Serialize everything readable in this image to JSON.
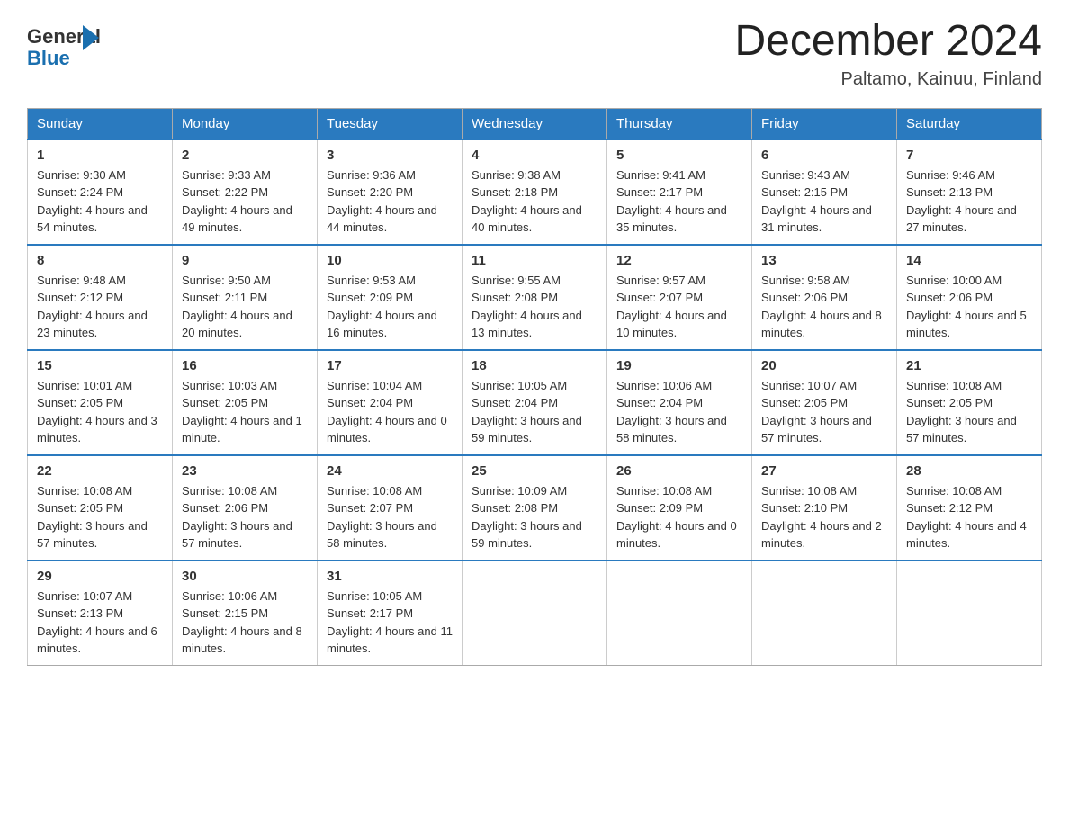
{
  "header": {
    "logo_general": "General",
    "logo_blue": "Blue",
    "month_title": "December 2024",
    "location": "Paltamo, Kainuu, Finland"
  },
  "columns": [
    "Sunday",
    "Monday",
    "Tuesday",
    "Wednesday",
    "Thursday",
    "Friday",
    "Saturday"
  ],
  "weeks": [
    [
      {
        "day": "1",
        "sunrise": "Sunrise: 9:30 AM",
        "sunset": "Sunset: 2:24 PM",
        "daylight": "Daylight: 4 hours and 54 minutes."
      },
      {
        "day": "2",
        "sunrise": "Sunrise: 9:33 AM",
        "sunset": "Sunset: 2:22 PM",
        "daylight": "Daylight: 4 hours and 49 minutes."
      },
      {
        "day": "3",
        "sunrise": "Sunrise: 9:36 AM",
        "sunset": "Sunset: 2:20 PM",
        "daylight": "Daylight: 4 hours and 44 minutes."
      },
      {
        "day": "4",
        "sunrise": "Sunrise: 9:38 AM",
        "sunset": "Sunset: 2:18 PM",
        "daylight": "Daylight: 4 hours and 40 minutes."
      },
      {
        "day": "5",
        "sunrise": "Sunrise: 9:41 AM",
        "sunset": "Sunset: 2:17 PM",
        "daylight": "Daylight: 4 hours and 35 minutes."
      },
      {
        "day": "6",
        "sunrise": "Sunrise: 9:43 AM",
        "sunset": "Sunset: 2:15 PM",
        "daylight": "Daylight: 4 hours and 31 minutes."
      },
      {
        "day": "7",
        "sunrise": "Sunrise: 9:46 AM",
        "sunset": "Sunset: 2:13 PM",
        "daylight": "Daylight: 4 hours and 27 minutes."
      }
    ],
    [
      {
        "day": "8",
        "sunrise": "Sunrise: 9:48 AM",
        "sunset": "Sunset: 2:12 PM",
        "daylight": "Daylight: 4 hours and 23 minutes."
      },
      {
        "day": "9",
        "sunrise": "Sunrise: 9:50 AM",
        "sunset": "Sunset: 2:11 PM",
        "daylight": "Daylight: 4 hours and 20 minutes."
      },
      {
        "day": "10",
        "sunrise": "Sunrise: 9:53 AM",
        "sunset": "Sunset: 2:09 PM",
        "daylight": "Daylight: 4 hours and 16 minutes."
      },
      {
        "day": "11",
        "sunrise": "Sunrise: 9:55 AM",
        "sunset": "Sunset: 2:08 PM",
        "daylight": "Daylight: 4 hours and 13 minutes."
      },
      {
        "day": "12",
        "sunrise": "Sunrise: 9:57 AM",
        "sunset": "Sunset: 2:07 PM",
        "daylight": "Daylight: 4 hours and 10 minutes."
      },
      {
        "day": "13",
        "sunrise": "Sunrise: 9:58 AM",
        "sunset": "Sunset: 2:06 PM",
        "daylight": "Daylight: 4 hours and 8 minutes."
      },
      {
        "day": "14",
        "sunrise": "Sunrise: 10:00 AM",
        "sunset": "Sunset: 2:06 PM",
        "daylight": "Daylight: 4 hours and 5 minutes."
      }
    ],
    [
      {
        "day": "15",
        "sunrise": "Sunrise: 10:01 AM",
        "sunset": "Sunset: 2:05 PM",
        "daylight": "Daylight: 4 hours and 3 minutes."
      },
      {
        "day": "16",
        "sunrise": "Sunrise: 10:03 AM",
        "sunset": "Sunset: 2:05 PM",
        "daylight": "Daylight: 4 hours and 1 minute."
      },
      {
        "day": "17",
        "sunrise": "Sunrise: 10:04 AM",
        "sunset": "Sunset: 2:04 PM",
        "daylight": "Daylight: 4 hours and 0 minutes."
      },
      {
        "day": "18",
        "sunrise": "Sunrise: 10:05 AM",
        "sunset": "Sunset: 2:04 PM",
        "daylight": "Daylight: 3 hours and 59 minutes."
      },
      {
        "day": "19",
        "sunrise": "Sunrise: 10:06 AM",
        "sunset": "Sunset: 2:04 PM",
        "daylight": "Daylight: 3 hours and 58 minutes."
      },
      {
        "day": "20",
        "sunrise": "Sunrise: 10:07 AM",
        "sunset": "Sunset: 2:05 PM",
        "daylight": "Daylight: 3 hours and 57 minutes."
      },
      {
        "day": "21",
        "sunrise": "Sunrise: 10:08 AM",
        "sunset": "Sunset: 2:05 PM",
        "daylight": "Daylight: 3 hours and 57 minutes."
      }
    ],
    [
      {
        "day": "22",
        "sunrise": "Sunrise: 10:08 AM",
        "sunset": "Sunset: 2:05 PM",
        "daylight": "Daylight: 3 hours and 57 minutes."
      },
      {
        "day": "23",
        "sunrise": "Sunrise: 10:08 AM",
        "sunset": "Sunset: 2:06 PM",
        "daylight": "Daylight: 3 hours and 57 minutes."
      },
      {
        "day": "24",
        "sunrise": "Sunrise: 10:08 AM",
        "sunset": "Sunset: 2:07 PM",
        "daylight": "Daylight: 3 hours and 58 minutes."
      },
      {
        "day": "25",
        "sunrise": "Sunrise: 10:09 AM",
        "sunset": "Sunset: 2:08 PM",
        "daylight": "Daylight: 3 hours and 59 minutes."
      },
      {
        "day": "26",
        "sunrise": "Sunrise: 10:08 AM",
        "sunset": "Sunset: 2:09 PM",
        "daylight": "Daylight: 4 hours and 0 minutes."
      },
      {
        "day": "27",
        "sunrise": "Sunrise: 10:08 AM",
        "sunset": "Sunset: 2:10 PM",
        "daylight": "Daylight: 4 hours and 2 minutes."
      },
      {
        "day": "28",
        "sunrise": "Sunrise: 10:08 AM",
        "sunset": "Sunset: 2:12 PM",
        "daylight": "Daylight: 4 hours and 4 minutes."
      }
    ],
    [
      {
        "day": "29",
        "sunrise": "Sunrise: 10:07 AM",
        "sunset": "Sunset: 2:13 PM",
        "daylight": "Daylight: 4 hours and 6 minutes."
      },
      {
        "day": "30",
        "sunrise": "Sunrise: 10:06 AM",
        "sunset": "Sunset: 2:15 PM",
        "daylight": "Daylight: 4 hours and 8 minutes."
      },
      {
        "day": "31",
        "sunrise": "Sunrise: 10:05 AM",
        "sunset": "Sunset: 2:17 PM",
        "daylight": "Daylight: 4 hours and 11 minutes."
      },
      null,
      null,
      null,
      null
    ]
  ]
}
